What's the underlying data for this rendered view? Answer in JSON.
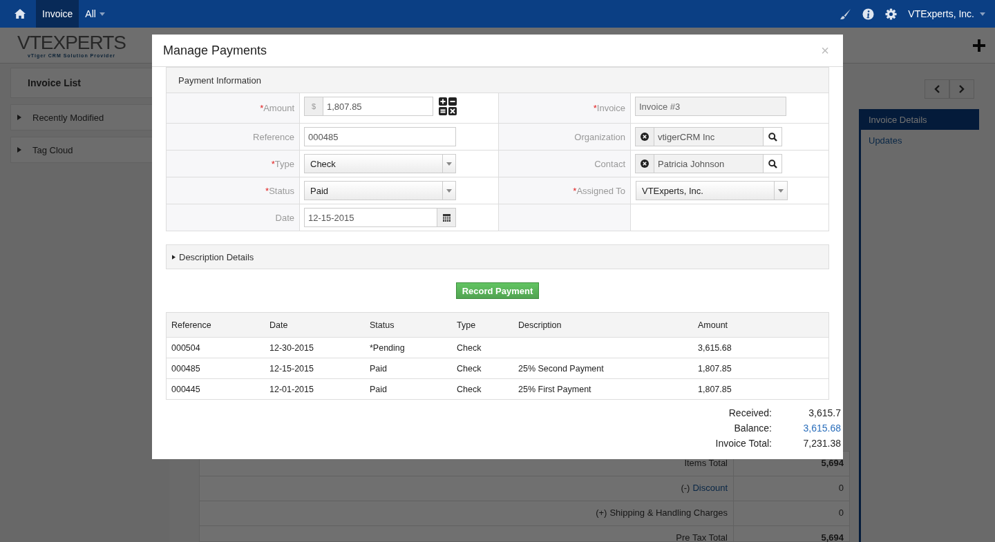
{
  "top_nav": {
    "items": [
      {
        "label": "Invoice",
        "selected": true,
        "dropdown": false
      },
      {
        "label": "All",
        "selected": false,
        "dropdown": true
      }
    ],
    "user": "VTExperts, Inc."
  },
  "logo": {
    "wordmark": "VTEXPERTS",
    "tagline": "vTiger  CRM Solution Provider"
  },
  "sidebar": {
    "title": "Invoice List",
    "sections": [
      {
        "label": "Recently Modified",
        "expanded": false
      },
      {
        "label": "Tag Cloud",
        "expanded": false
      }
    ]
  },
  "detail_tabs": [
    {
      "label": "Invoice Details",
      "selected": true
    },
    {
      "label": "Updates",
      "selected": false
    }
  ],
  "totals_table": {
    "rows": [
      {
        "kind": "total",
        "label": "Items Total",
        "value": "5,694"
      },
      {
        "kind": "link",
        "prefix": "(-)",
        "label": "Discount",
        "value": "0"
      },
      {
        "kind": "plain",
        "prefix": "(+)",
        "label": "Shipping & Handling Charges",
        "value": "0"
      },
      {
        "kind": "total",
        "label": "Pre Tax Total",
        "value": "5,694"
      }
    ]
  },
  "modal": {
    "title": "Manage Payments",
    "close": "×",
    "required_mark": "*",
    "section_title": "Payment Information",
    "left_fields": [
      {
        "label": "Amount",
        "required": true,
        "kind": "currency",
        "prefix": "$",
        "value": "1,807.85"
      },
      {
        "label": "Reference",
        "required": false,
        "kind": "text",
        "value": "000485"
      },
      {
        "label": "Type",
        "required": true,
        "kind": "select",
        "value": "Check"
      },
      {
        "label": "Status",
        "required": true,
        "kind": "select",
        "value": "Paid"
      },
      {
        "label": "Date",
        "required": false,
        "kind": "date",
        "value": "12-15-2015"
      }
    ],
    "right_fields": [
      {
        "label": "Invoice",
        "required": true,
        "kind": "readonly",
        "value": "Invoice #3"
      },
      {
        "label": "Organization",
        "required": false,
        "kind": "reference",
        "value": "vtigerCRM Inc"
      },
      {
        "label": "Contact",
        "required": false,
        "kind": "reference",
        "value": "Patricia Johnson"
      },
      {
        "label": "Assigned To",
        "required": true,
        "kind": "select",
        "value": "VTExperts, Inc."
      }
    ],
    "description": {
      "label": "Description Details",
      "expanded": false
    },
    "record_button": "Record Payment",
    "payments": {
      "columns": [
        "Reference",
        "Date",
        "Status",
        "Type",
        "Description",
        "Amount"
      ],
      "rows": [
        [
          "000504",
          "12-30-2015",
          "*Pending",
          "Check",
          null,
          "3,615.68"
        ],
        [
          "000485",
          "12-15-2015",
          "Paid",
          "Check",
          "25% Second Payment",
          "1,807.85"
        ],
        [
          "000445",
          "12-01-2015",
          "Paid",
          "Check",
          "25% First Payment",
          "1,807.85"
        ]
      ]
    },
    "totals": [
      {
        "kind": "plain",
        "label": "Received:",
        "value": "3,615.7"
      },
      {
        "kind": "link",
        "label": "Balance:",
        "value": "3,615.68"
      },
      {
        "kind": "plain",
        "label": "Invoice Total:",
        "value": "7,231.38"
      }
    ]
  }
}
